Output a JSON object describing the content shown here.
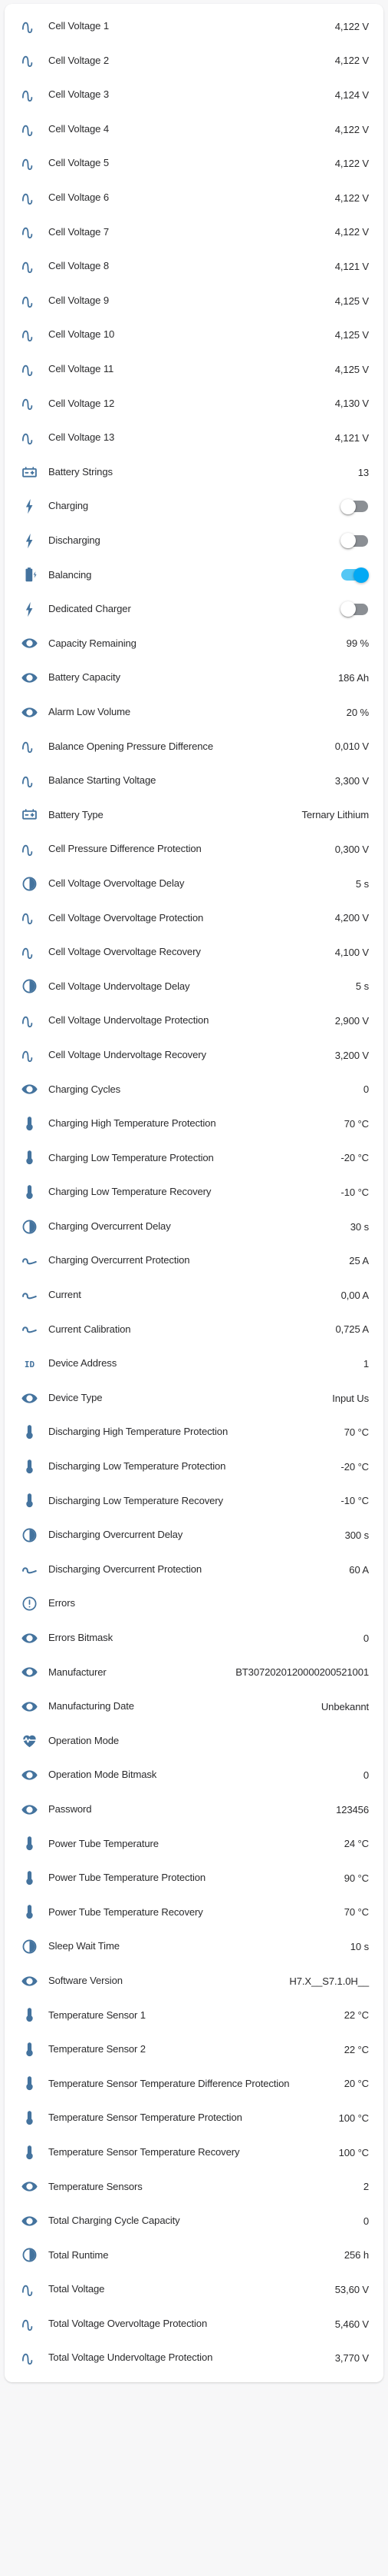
{
  "card": {
    "accent_icon_color": "#44739e",
    "text_color": "#2b2b2d",
    "toggle_on_color": "#03a9f4",
    "toggle_off_color": "#8b8f94"
  },
  "rows": [
    {
      "icon": "sine-wave-icon",
      "label": "Cell Voltage 1",
      "value": "4,122 V",
      "type": "value"
    },
    {
      "icon": "sine-wave-icon",
      "label": "Cell Voltage 2",
      "value": "4,122 V",
      "type": "value"
    },
    {
      "icon": "sine-wave-icon",
      "label": "Cell Voltage 3",
      "value": "4,124 V",
      "type": "value"
    },
    {
      "icon": "sine-wave-icon",
      "label": "Cell Voltage 4",
      "value": "4,122 V",
      "type": "value"
    },
    {
      "icon": "sine-wave-icon",
      "label": "Cell Voltage 5",
      "value": "4,122 V",
      "type": "value"
    },
    {
      "icon": "sine-wave-icon",
      "label": "Cell Voltage 6",
      "value": "4,122 V",
      "type": "value"
    },
    {
      "icon": "sine-wave-icon",
      "label": "Cell Voltage 7",
      "value": "4,122 V",
      "type": "value"
    },
    {
      "icon": "sine-wave-icon",
      "label": "Cell Voltage 8",
      "value": "4,121 V",
      "type": "value"
    },
    {
      "icon": "sine-wave-icon",
      "label": "Cell Voltage 9",
      "value": "4,125 V",
      "type": "value"
    },
    {
      "icon": "sine-wave-icon",
      "label": "Cell Voltage 10",
      "value": "4,125 V",
      "type": "value"
    },
    {
      "icon": "sine-wave-icon",
      "label": "Cell Voltage 11",
      "value": "4,125 V",
      "type": "value"
    },
    {
      "icon": "sine-wave-icon",
      "label": "Cell Voltage 12",
      "value": "4,130 V",
      "type": "value"
    },
    {
      "icon": "sine-wave-icon",
      "label": "Cell Voltage 13",
      "value": "4,121 V",
      "type": "value"
    },
    {
      "icon": "battery-icon",
      "label": "Battery Strings",
      "value": "13",
      "type": "value"
    },
    {
      "icon": "flash-icon",
      "label": "Charging",
      "value": "off",
      "type": "toggle"
    },
    {
      "icon": "flash-icon",
      "label": "Discharging",
      "value": "off",
      "type": "toggle"
    },
    {
      "icon": "battery-charging-icon",
      "label": "Balancing",
      "value": "on",
      "type": "toggle"
    },
    {
      "icon": "flash-icon",
      "label": "Dedicated Charger",
      "value": "off",
      "type": "toggle"
    },
    {
      "icon": "eye-icon",
      "label": "Capacity Remaining",
      "value": "99 %",
      "type": "value"
    },
    {
      "icon": "eye-icon",
      "label": "Battery Capacity",
      "value": "186 Ah",
      "type": "value"
    },
    {
      "icon": "eye-icon",
      "label": "Alarm Low Volume",
      "value": "20 %",
      "type": "value"
    },
    {
      "icon": "sine-wave-icon",
      "label": "Balance Opening Pressure Difference",
      "value": "0,010 V",
      "type": "value"
    },
    {
      "icon": "sine-wave-icon",
      "label": "Balance Starting Voltage",
      "value": "3,300 V",
      "type": "value"
    },
    {
      "icon": "battery-icon",
      "label": "Battery Type",
      "value": "Ternary Lithium",
      "type": "value"
    },
    {
      "icon": "sine-wave-icon",
      "label": "Cell Pressure Difference Protection",
      "value": "0,300 V",
      "type": "value"
    },
    {
      "icon": "timer-icon",
      "label": "Cell Voltage Overvoltage Delay",
      "value": "5 s",
      "type": "value"
    },
    {
      "icon": "sine-wave-icon",
      "label": "Cell Voltage Overvoltage Protection",
      "value": "4,200 V",
      "type": "value"
    },
    {
      "icon": "sine-wave-icon",
      "label": "Cell Voltage Overvoltage Recovery",
      "value": "4,100 V",
      "type": "value"
    },
    {
      "icon": "timer-icon",
      "label": "Cell Voltage Undervoltage Delay",
      "value": "5 s",
      "type": "value"
    },
    {
      "icon": "sine-wave-icon",
      "label": "Cell Voltage Undervoltage Protection",
      "value": "2,900 V",
      "type": "value"
    },
    {
      "icon": "sine-wave-icon",
      "label": "Cell Voltage Undervoltage Recovery",
      "value": "3,200 V",
      "type": "value"
    },
    {
      "icon": "eye-icon",
      "label": "Charging Cycles",
      "value": "0",
      "type": "value"
    },
    {
      "icon": "thermometer-icon",
      "label": "Charging High Temperature Protection",
      "value": "70 °C",
      "type": "value"
    },
    {
      "icon": "thermometer-icon",
      "label": "Charging Low Temperature Protection",
      "value": "-20 °C",
      "type": "value"
    },
    {
      "icon": "thermometer-icon",
      "label": "Charging Low Temperature Recovery",
      "value": "-10 °C",
      "type": "value"
    },
    {
      "icon": "timer-icon",
      "label": "Charging Overcurrent Delay",
      "value": "30 s",
      "type": "value"
    },
    {
      "icon": "current-ac-icon",
      "label": "Charging Overcurrent Protection",
      "value": "25 A",
      "type": "value"
    },
    {
      "icon": "current-ac-icon",
      "label": "Current",
      "value": "0,00 A",
      "type": "value"
    },
    {
      "icon": "current-ac-icon",
      "label": "Current Calibration",
      "value": "0,725 A",
      "type": "value"
    },
    {
      "icon": "identifier-icon",
      "label": "Device Address",
      "value": "1",
      "type": "value"
    },
    {
      "icon": "eye-icon",
      "label": "Device Type",
      "value": "Input Us",
      "type": "value"
    },
    {
      "icon": "thermometer-icon",
      "label": "Discharging High Temperature Protection",
      "value": "70 °C",
      "type": "value"
    },
    {
      "icon": "thermometer-icon",
      "label": "Discharging Low Temperature Protection",
      "value": "-20 °C",
      "type": "value"
    },
    {
      "icon": "thermometer-icon",
      "label": "Discharging Low Temperature Recovery",
      "value": "-10 °C",
      "type": "value"
    },
    {
      "icon": "timer-icon",
      "label": "Discharging Overcurrent Delay",
      "value": "300 s",
      "type": "value"
    },
    {
      "icon": "current-ac-icon",
      "label": "Discharging Overcurrent Protection",
      "value": "60 A",
      "type": "value"
    },
    {
      "icon": "alert-circle-icon",
      "label": "Errors",
      "value": "",
      "type": "value"
    },
    {
      "icon": "eye-icon",
      "label": "Errors Bitmask",
      "value": "0",
      "type": "value"
    },
    {
      "icon": "eye-icon",
      "label": "Manufacturer",
      "value": "BT3072020120000200521001",
      "type": "value"
    },
    {
      "icon": "eye-icon",
      "label": "Manufacturing Date",
      "value": "Unbekannt",
      "type": "value"
    },
    {
      "icon": "heart-pulse-icon",
      "label": "Operation Mode",
      "value": "",
      "type": "value"
    },
    {
      "icon": "eye-icon",
      "label": "Operation Mode Bitmask",
      "value": "0",
      "type": "value"
    },
    {
      "icon": "eye-icon",
      "label": "Password",
      "value": "123456",
      "type": "value"
    },
    {
      "icon": "thermometer-icon",
      "label": "Power Tube Temperature",
      "value": "24 °C",
      "type": "value"
    },
    {
      "icon": "thermometer-icon",
      "label": "Power Tube Temperature Protection",
      "value": "90 °C",
      "type": "value"
    },
    {
      "icon": "thermometer-icon",
      "label": "Power Tube Temperature Recovery",
      "value": "70 °C",
      "type": "value"
    },
    {
      "icon": "timer-icon",
      "label": "Sleep Wait Time",
      "value": "10 s",
      "type": "value"
    },
    {
      "icon": "eye-icon",
      "label": "Software Version",
      "value": "H7.X__S7.1.0H__",
      "type": "value"
    },
    {
      "icon": "thermometer-icon",
      "label": "Temperature Sensor 1",
      "value": "22 °C",
      "type": "value"
    },
    {
      "icon": "thermometer-icon",
      "label": "Temperature Sensor 2",
      "value": "22 °C",
      "type": "value"
    },
    {
      "icon": "thermometer-icon",
      "label": "Temperature Sensor Temperature Difference Protection",
      "value": "20 °C",
      "type": "value"
    },
    {
      "icon": "thermometer-icon",
      "label": "Temperature Sensor Temperature Protection",
      "value": "100 °C",
      "type": "value"
    },
    {
      "icon": "thermometer-icon",
      "label": "Temperature Sensor Temperature Recovery",
      "value": "100 °C",
      "type": "value"
    },
    {
      "icon": "eye-icon",
      "label": "Temperature Sensors",
      "value": "2",
      "type": "value"
    },
    {
      "icon": "eye-icon",
      "label": "Total Charging Cycle Capacity",
      "value": "0",
      "type": "value"
    },
    {
      "icon": "timer-icon",
      "label": "Total Runtime",
      "value": "256 h",
      "type": "value"
    },
    {
      "icon": "sine-wave-icon",
      "label": "Total Voltage",
      "value": "53,60 V",
      "type": "value"
    },
    {
      "icon": "sine-wave-icon",
      "label": "Total Voltage Overvoltage Protection",
      "value": "5,460 V",
      "type": "value"
    },
    {
      "icon": "sine-wave-icon",
      "label": "Total Voltage Undervoltage Protection",
      "value": "3,770 V",
      "type": "value"
    }
  ]
}
